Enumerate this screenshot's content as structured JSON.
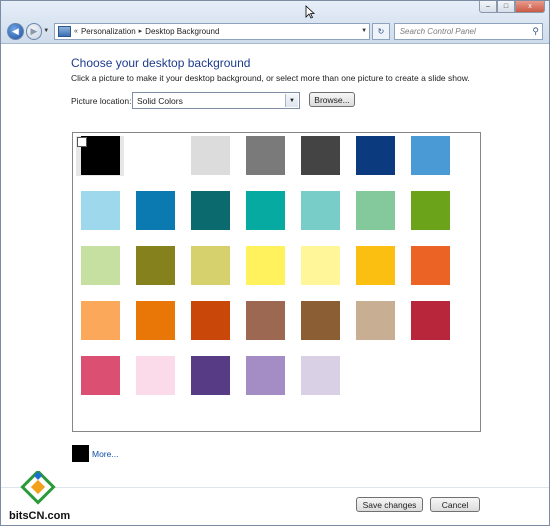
{
  "nav": {
    "breadcrumb_sep": "«",
    "crumb1": "Personalization",
    "crumb_arrow": "▸",
    "crumb2": "Desktop Background",
    "search_placeholder": "Search Control Panel"
  },
  "caption_buttons": {
    "minimize": "–",
    "maximize": "□",
    "close": "x"
  },
  "main": {
    "heading": "Choose your desktop background",
    "subtext": "Click a picture to make it your desktop background, or select more than one picture to create a slide show.",
    "location_label": "Picture location:",
    "location_value": "Solid Colors",
    "browse_label": "Browse..."
  },
  "swatches": [
    [
      "#000000",
      "#ffffff",
      "#dcdcdc",
      "#7a7a7a",
      "#444444",
      "#0b3a7e",
      "#4a9ad6"
    ],
    [
      "#9ed8ec",
      "#0b7ab0",
      "#0a6a6e",
      "#06aaa0",
      "#79cdc8",
      "#84c99c",
      "#6ba41a"
    ],
    [
      "#c5e0a1",
      "#85821e",
      "#d6d16c",
      "#fff25c",
      "#fff69a",
      "#fbbf12",
      "#ec6425"
    ],
    [
      "#fba85a",
      "#e87707",
      "#c94708",
      "#9c6852",
      "#8b5e34",
      "#c8af93",
      "#b8263c"
    ],
    [
      "#db4f73",
      "#fbdaea",
      "#573b84",
      "#a48cc4",
      "#d9d0e6"
    ]
  ],
  "more": {
    "label": "More...",
    "color": "#000000"
  },
  "footer": {
    "save_label": "Save changes",
    "cancel_label": "Cancel"
  },
  "watermark": {
    "text": "bitsCN.com"
  }
}
